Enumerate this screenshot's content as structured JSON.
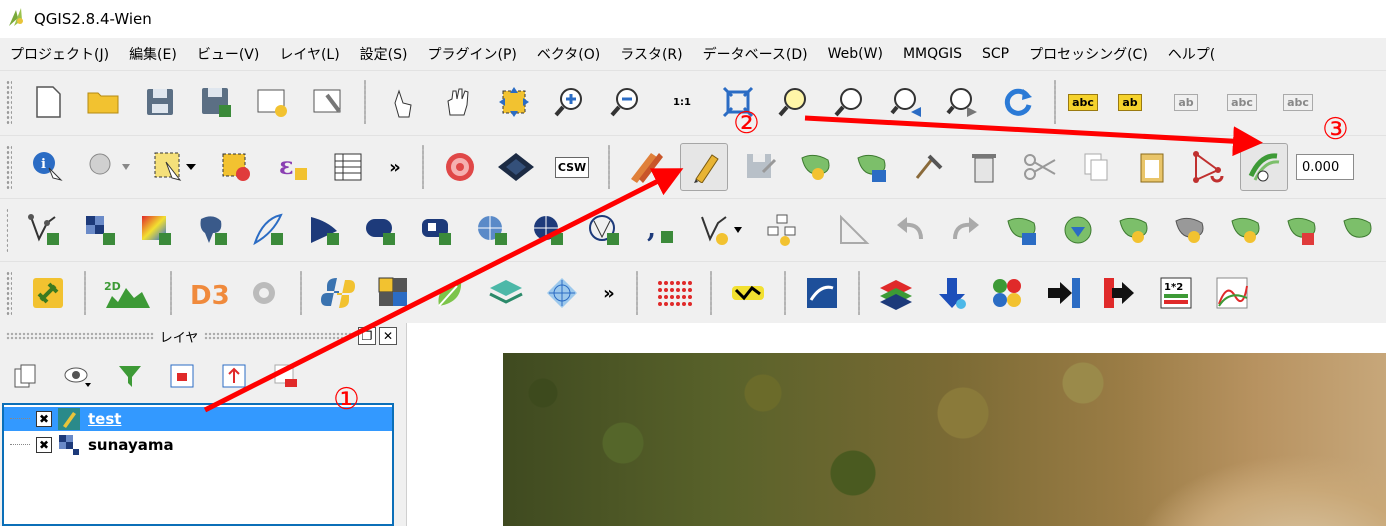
{
  "window": {
    "title": "QGIS2.8.4-Wien"
  },
  "menu": [
    "プロジェクト(J)",
    "編集(E)",
    "ビュー(V)",
    "レイヤ(L)",
    "設定(S)",
    "プラグイン(P)",
    "ベクタ(O)",
    "ラスタ(R)",
    "データベース(D)",
    "Web(W)",
    "MMQGIS",
    "SCP",
    "プロセッシング(C)",
    "ヘルプ("
  ],
  "toolbar1": {
    "icons": {
      "label_abc_1": "abc",
      "label_abc_2": "ab",
      "label_abc_3": "ab",
      "label_abc_4": "abc",
      "label_abc_5": "abc",
      "zoom_1to1": "1:1"
    }
  },
  "toolbar2": {
    "csw_label": "CSW",
    "overflow": "»",
    "offset_value": "0.000"
  },
  "toolbar4": {
    "overflow": "»",
    "twod_label": "2D",
    "ratio_label": "1*2"
  },
  "layers_panel": {
    "title": "レイヤ",
    "items": [
      {
        "name": "test",
        "checked": "✖",
        "selected": true
      },
      {
        "name": "sunayama",
        "checked": "✖",
        "selected": false
      }
    ]
  },
  "annotations": {
    "one": "①",
    "two": "②",
    "three": "③",
    "color": "#ff0000"
  }
}
